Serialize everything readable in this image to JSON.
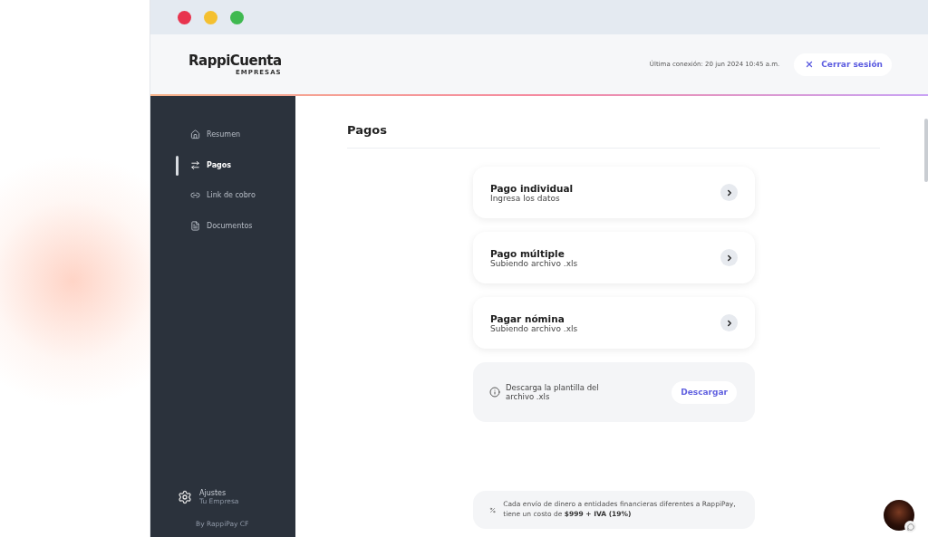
{
  "header": {
    "logo": "RappiCuenta",
    "logo_subtitle": "EMPRESAS",
    "last_connection": "Última conexión:  20 jun 2024 10:45 a.m.",
    "logout": "Cerrar sesión"
  },
  "sidebar": {
    "items": [
      {
        "label": "Resumen",
        "kind": "home",
        "selected": false
      },
      {
        "label": "Pagos",
        "kind": "transfer",
        "selected": true
      },
      {
        "label": "Link de cobro",
        "kind": "link",
        "selected": false
      },
      {
        "label": "Documentos",
        "kind": "document",
        "selected": false
      }
    ],
    "settings": {
      "title": "Ajustes",
      "subtitle": "Tu Empresa"
    },
    "footer": "By RappiPay CF"
  },
  "page": {
    "title": "Pagos",
    "options": [
      {
        "title": "Pago individual",
        "subtitle": "Ingresa los datos"
      },
      {
        "title": "Pago múltiple",
        "subtitle": "Subiendo archivo .xls"
      },
      {
        "title": "Pagar nómina",
        "subtitle": "Subiendo archivo .xls"
      }
    ],
    "download": {
      "text": "Descarga la plantilla del archivo .xls",
      "button": "Descargar"
    },
    "note": "Cada envío de dinero a entidades financieras diferentes a RappiPay, tiene un costo de **$999 + IVA (19%)**"
  }
}
